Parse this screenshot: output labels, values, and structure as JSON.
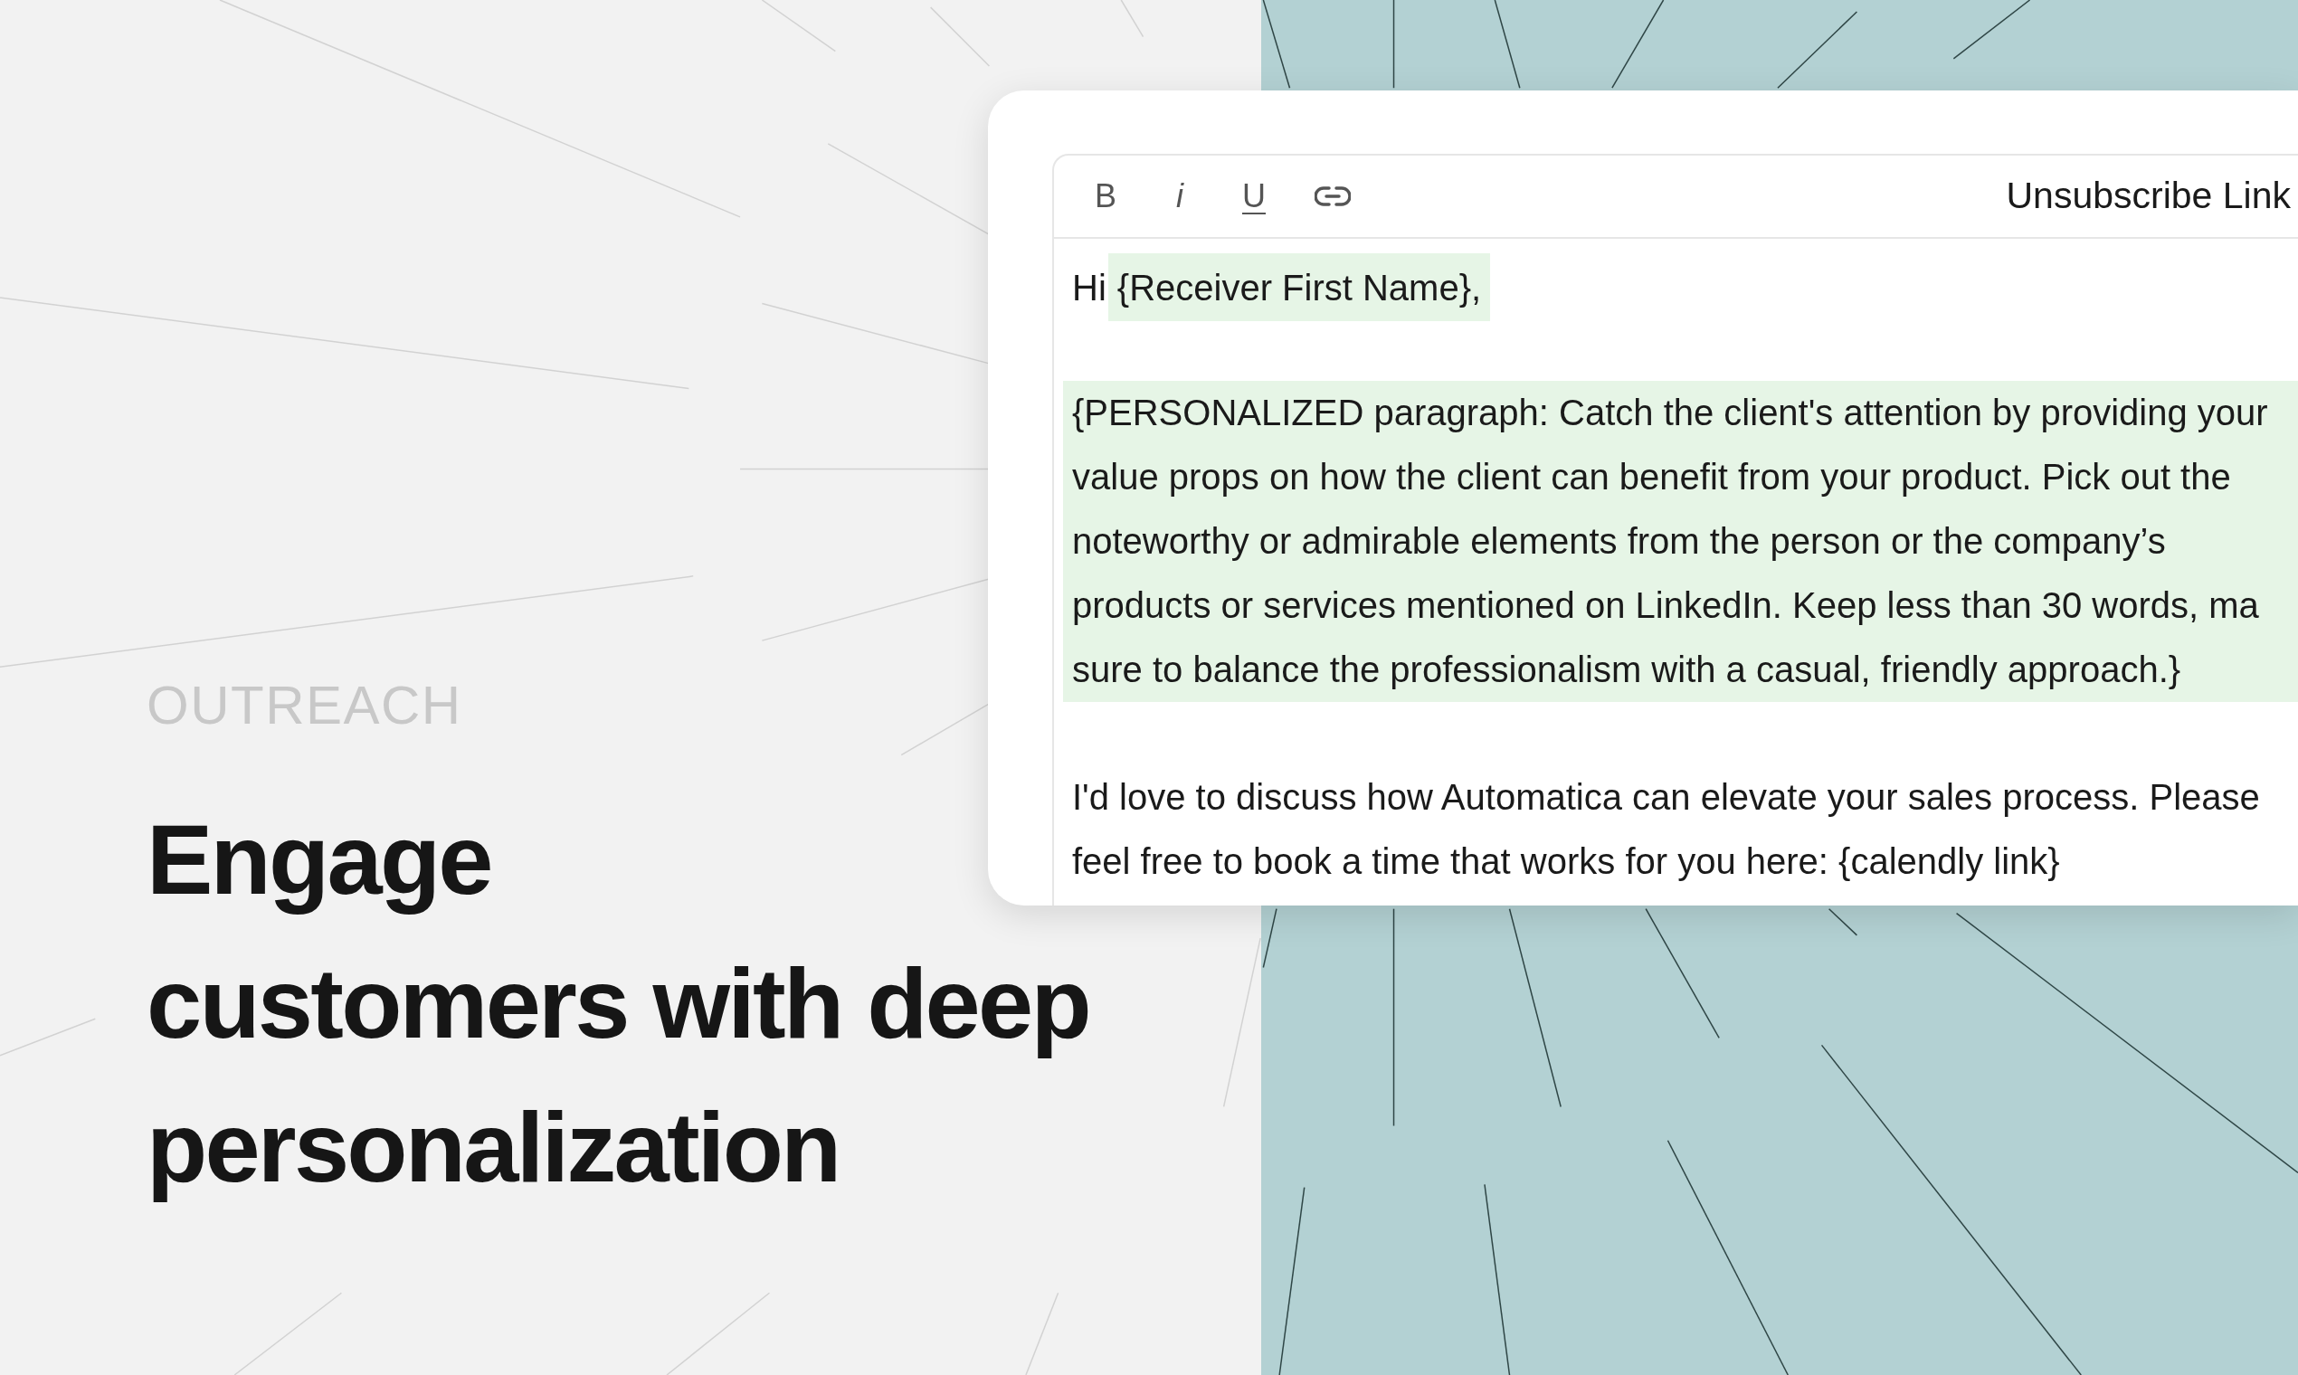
{
  "eyebrow": "OUTREACH",
  "headline": [
    "Engage",
    "customers with deep",
    "personalization"
  ],
  "editor": {
    "toolbar": {
      "format_buttons": [
        "B",
        "i",
        "U"
      ],
      "action": "Unsubscribe Link"
    },
    "body": [
      {
        "kind": "greeting",
        "salutation": "Hi",
        "variable": "{Receiver First Name},"
      },
      {
        "kind": "paragraph",
        "highlighted": true,
        "lines": [
          "{PERSONALIZED paragraph: Catch the client's attention by providing your",
          "value props on how the client can benefit from your product. Pick out the",
          "noteworthy or admirable elements from the person or the company’s",
          "products or services mentioned on LinkedIn. Keep less than 30 words, ma",
          "sure to balance the professionalism with a casual, friendly approach.}"
        ]
      },
      {
        "kind": "paragraph",
        "highlighted": false,
        "lines": [
          "I'd love to discuss how Automatica can elevate your sales process. Please",
          "feel free to book a time that works for you here: {calendly link}"
        ]
      }
    ]
  }
}
